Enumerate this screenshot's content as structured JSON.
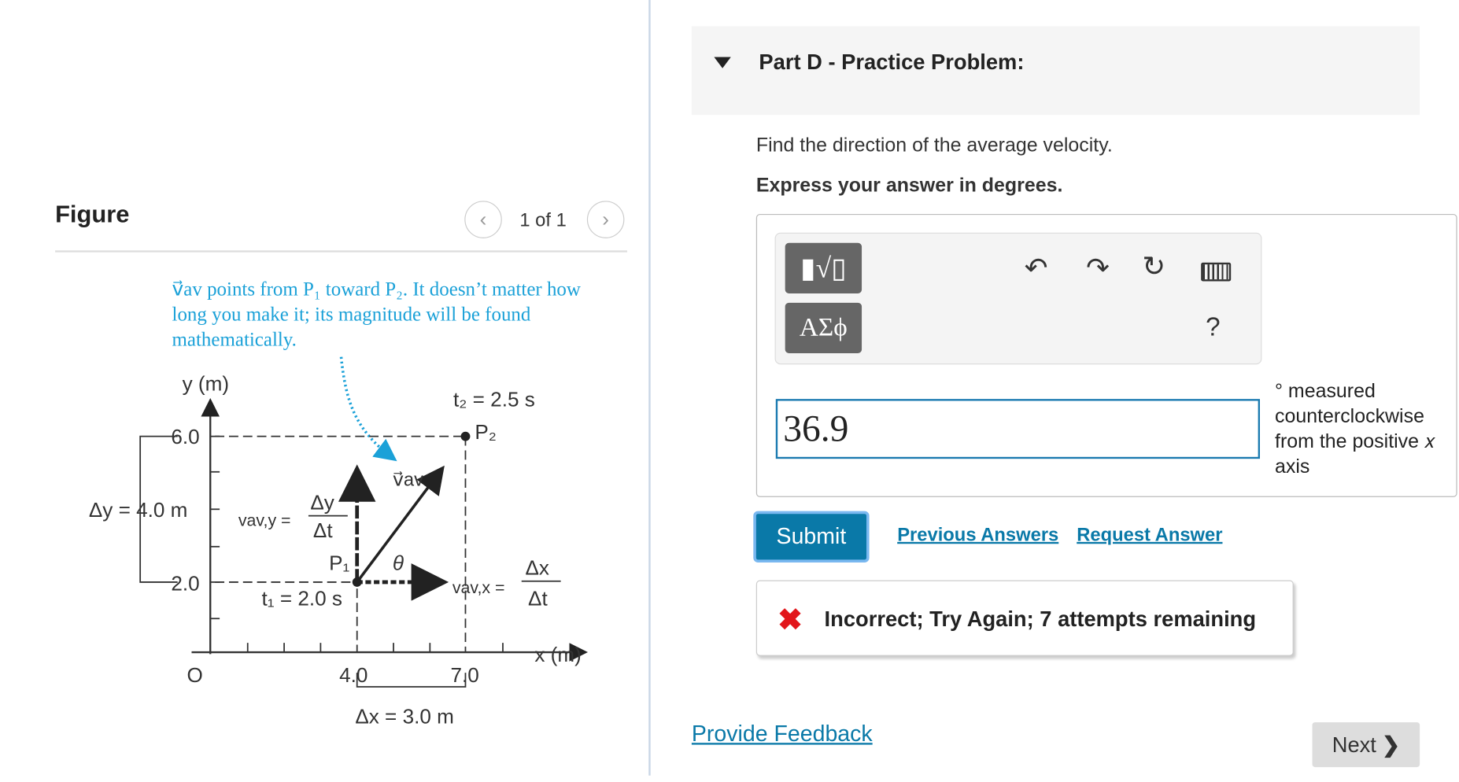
{
  "figure": {
    "title": "Figure",
    "pager": "1 of 1",
    "caption": "v⃗av points from P₁ toward P₂. It doesn’t matter how long you make it; its magnitude will be found mathematically.",
    "labels": {
      "y_axis": "y (m)",
      "x_axis": "x (m)",
      "origin": "O",
      "y6": "6.0",
      "y2": "2.0",
      "x4": "4.0",
      "x7": "7.0",
      "t2": "t₂ = 2.5 s",
      "t1": "t₁ = 2.0 s",
      "p1": "P₁",
      "p2": "P₂",
      "dy": "Δy = 4.0 m",
      "dx": "Δx = 3.0 m",
      "vavy": "vav,y =",
      "vavx": "vav,x =",
      "dy_frac_num": "Δy",
      "dx_frac_num": "Δx",
      "dt": "Δt",
      "vav": "v⃗av",
      "theta": "θ"
    }
  },
  "part": {
    "title": "Part D - Practice Problem:",
    "question": "Find the direction of the average velocity.",
    "instruction": "Express your answer in degrees.",
    "toolbar": {
      "templates": "▮√▯",
      "greek": "ΑΣϕ",
      "help": "?"
    },
    "answer_value": "36.9",
    "unit_text": "° measured counterclockwise from the positive 𝑥 axis",
    "submit": "Submit",
    "previous_answers": "Previous Answers",
    "request_answer": "Request Answer",
    "feedback": "Incorrect; Try Again; 7 attempts remaining",
    "feedback_icon": "✖"
  },
  "footer": {
    "provide_feedback": "Provide Feedback",
    "next": "Next"
  },
  "colors": {
    "accent": "#0a79a8",
    "caption": "#1ba1d8",
    "error": "#e2161b"
  }
}
